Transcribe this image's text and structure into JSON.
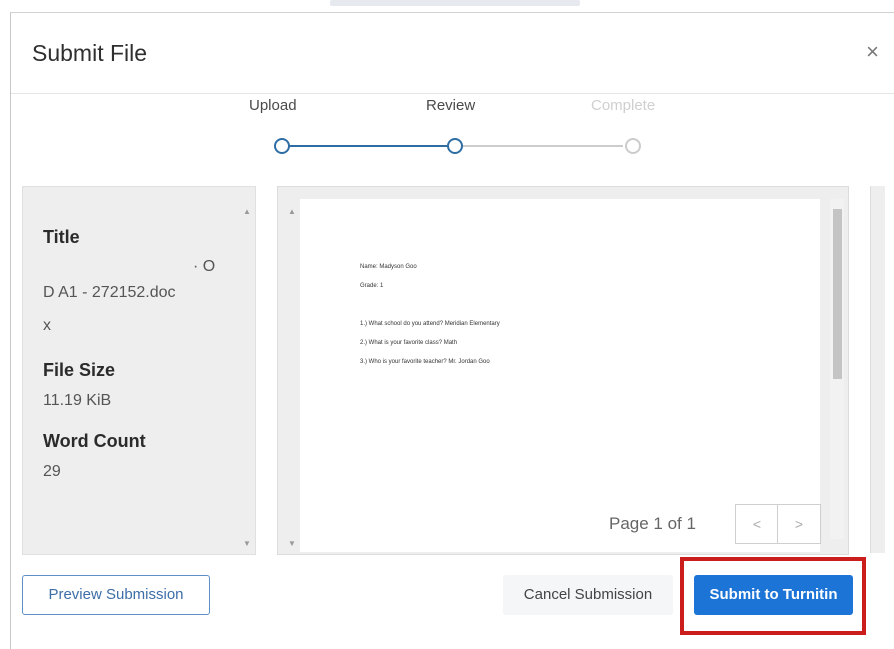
{
  "dialog": {
    "title": "Submit File",
    "close_glyph": "×"
  },
  "stepper": {
    "steps": [
      {
        "label": "Upload",
        "state": "done"
      },
      {
        "label": "Review",
        "state": "current"
      },
      {
        "label": "Complete",
        "state": "pending"
      }
    ],
    "active_color": "#2e6da4",
    "inactive_color": "#cccccc"
  },
  "file_info": {
    "title_label": "Title",
    "title_value_line1": "· O",
    "title_value_line2": "D A1 - 272152.doc",
    "title_value_line3": "x",
    "size_label": "File Size",
    "size_value": "11.19 KiB",
    "word_count_label": "Word Count",
    "word_count_value": "29"
  },
  "preview": {
    "lines": [
      "Name: Madyson Goo",
      "Grade: 1",
      "1.) What school do you attend? Meridian Elementary",
      "2.) What is your favorite class? Math",
      "3.) Who is your favorite teacher? Mr. Jordan Goo"
    ],
    "pager_text": "Page 1 of 1",
    "prev_glyph": "<",
    "next_glyph": ">"
  },
  "footer": {
    "preview_button": "Preview Submission",
    "cancel_button": "Cancel Submission",
    "submit_button": "Submit to Turnitin"
  }
}
